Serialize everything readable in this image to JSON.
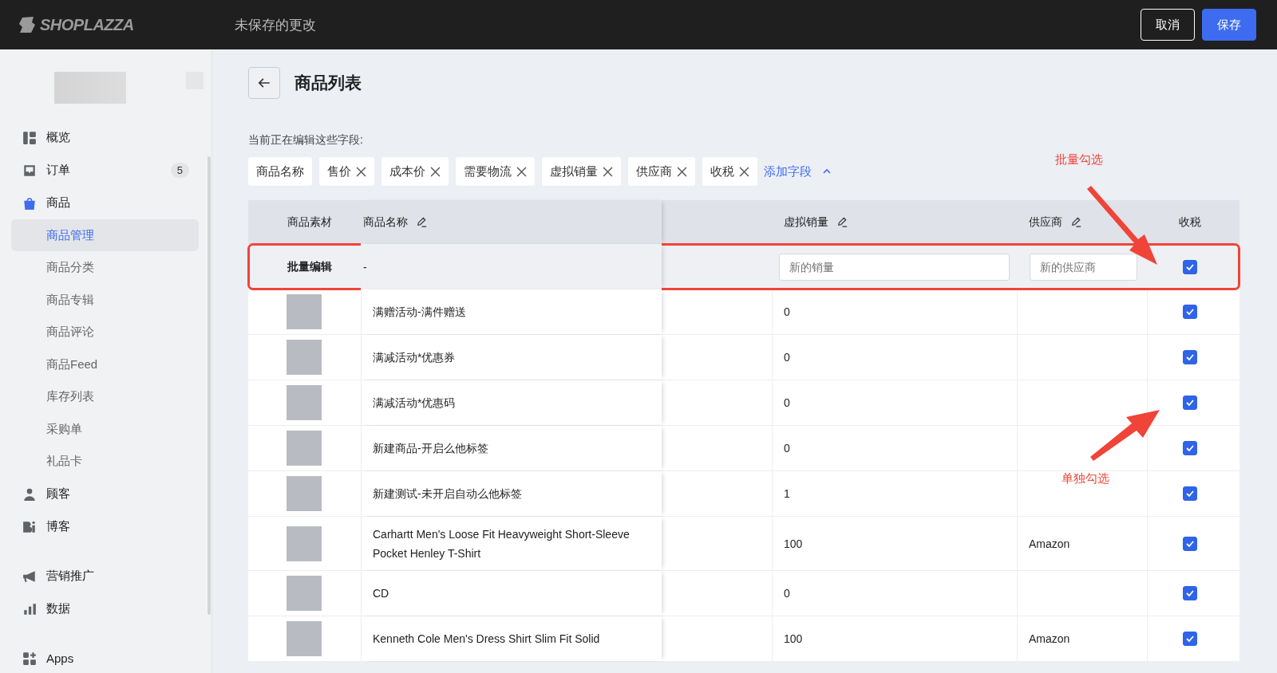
{
  "topbar": {
    "logo": "SHOPLAZZA",
    "title": "未保存的更改",
    "buttons": [
      {
        "label": "取消",
        "kind": "secondary"
      },
      {
        "label": "保存",
        "kind": "primary"
      }
    ]
  },
  "sidebar": {
    "groups": [
      [
        {
          "label": "概览",
          "selected": false
        },
        {
          "label": "订单",
          "selected": false,
          "badge": "5"
        },
        {
          "label": "商品",
          "selected": true,
          "children": [
            {
              "label": "商品管理",
              "selected": true
            },
            {
              "label": "商品分类",
              "selected": false
            },
            {
              "label": "商品专辑",
              "selected": false
            },
            {
              "label": "商品评论",
              "selected": false
            },
            {
              "label": "商品Feed",
              "selected": false
            },
            {
              "label": "库存列表",
              "selected": false
            },
            {
              "label": "采购单",
              "selected": false
            },
            {
              "label": "礼品卡",
              "selected": false
            }
          ]
        },
        {
          "label": "顾客",
          "selected": false
        },
        {
          "label": "博客",
          "selected": false
        }
      ],
      [
        {
          "label": "营销推广",
          "selected": false
        },
        {
          "label": "数据",
          "selected": false
        }
      ],
      [
        {
          "label": "Apps",
          "selected": false
        }
      ]
    ]
  },
  "page": {
    "title": "商品列表",
    "editing_label": "当前正在编辑这些字段:",
    "tags": [
      {
        "label": "商品名称",
        "removable": false
      },
      {
        "label": "售价",
        "removable": true
      },
      {
        "label": "成本价",
        "removable": true
      },
      {
        "label": "需要物流",
        "removable": true
      },
      {
        "label": "虚拟销量",
        "removable": true
      },
      {
        "label": "供应商",
        "removable": true
      },
      {
        "label": "收税",
        "removable": true
      }
    ],
    "add_field": {
      "label": "添加字段",
      "expanded": true
    }
  },
  "table": {
    "columns": [
      {
        "label": "商品素材",
        "editable": false
      },
      {
        "label": "商品名称",
        "editable": true
      },
      {
        "label": "虚拟销量",
        "editable": true
      },
      {
        "label": "供应商",
        "editable": true
      },
      {
        "label": "收税",
        "editable": false
      }
    ],
    "batch_row": {
      "label": "批量编辑",
      "name": "-",
      "sales_placeholder": "新的销量",
      "supplier_placeholder": "新的供应商",
      "tax_checked": true,
      "highlighted": true
    },
    "rows": [
      {
        "name": "满赠活动-满件赠送",
        "sales": "0",
        "tax_checked": true
      },
      {
        "name": "满减活动*优惠券",
        "sales": "0",
        "tax_checked": true
      },
      {
        "name": "满减活动*优惠码",
        "sales": "0",
        "tax_checked": true
      },
      {
        "name": "新建商品-开启么他标签",
        "sales": "0",
        "tax_checked": true
      },
      {
        "name": "新建测试-未开启自动么他标签",
        "sales": "1",
        "tax_checked": true
      },
      {
        "name": "Carhartt Men's Loose Fit Heavyweight Short-Sleeve Pocket Henley T-Shirt",
        "sales": "100",
        "supplier": "Amazon",
        "tax_checked": true
      },
      {
        "name": "CD",
        "sales": "0",
        "tax_checked": true
      },
      {
        "name": "Kenneth Cole Men's Dress Shirt Slim Fit Solid",
        "sales": "100",
        "supplier": "Amazon",
        "tax_checked": true
      }
    ]
  },
  "annotations": [
    {
      "text": "批量勾选"
    },
    {
      "text": "单独勾选"
    }
  ]
}
